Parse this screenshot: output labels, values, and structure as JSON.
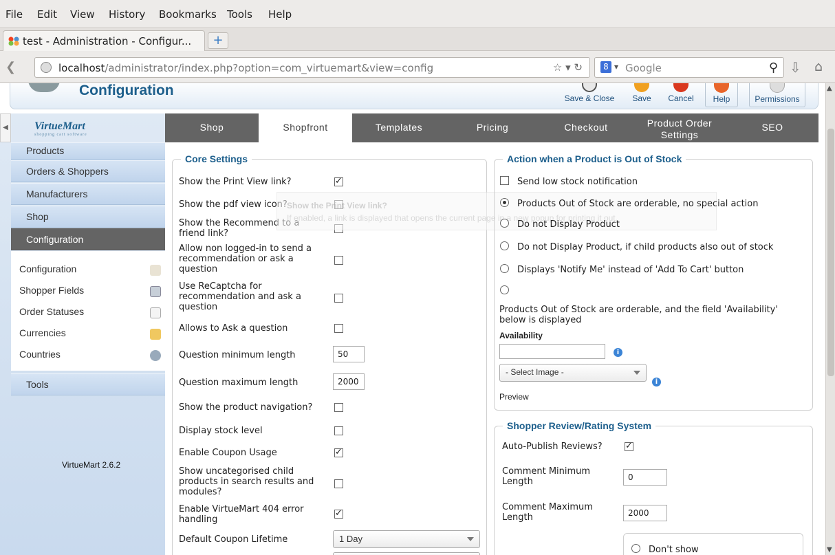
{
  "browser": {
    "menu": [
      "File",
      "Edit",
      "View",
      "History",
      "Bookmarks",
      "Tools",
      "Help"
    ],
    "tab_title": "test - Administration - Configur...",
    "new_tab": "+",
    "url_host": "localhost",
    "url_path": "/administrator/index.php?option=com_virtuemart&view=config",
    "search_engine_letter": "8",
    "search_placeholder": "Google"
  },
  "toolbar": {
    "title": "Configuration",
    "buttons": [
      {
        "label": "Save & Close",
        "icon": "save-close-icon",
        "color": "#555555"
      },
      {
        "label": "Save",
        "icon": "save-icon",
        "color": "#f0a020"
      },
      {
        "label": "Cancel",
        "icon": "cancel-icon",
        "color": "#d9381e"
      },
      {
        "label": "Help",
        "icon": "help-icon",
        "color": "#e8652a"
      },
      {
        "label": "Permissions",
        "icon": "permissions-icon",
        "color": "#aaaaaa"
      }
    ]
  },
  "vm_tabs": [
    {
      "label": "Shop",
      "active": false
    },
    {
      "label": "Shopfront",
      "active": true
    },
    {
      "label": "Templates",
      "active": false
    },
    {
      "label": "Pricing",
      "active": false
    },
    {
      "label": "Checkout",
      "active": false
    },
    {
      "label": "Product Order Settings",
      "active": false
    },
    {
      "label": "SEO",
      "active": false
    }
  ],
  "sidebar": {
    "logo": "VirtueMart",
    "logo_tagline": "shopping cart software",
    "items": [
      "Products",
      "Orders & Shoppers",
      "Manufacturers",
      "Shop",
      "Configuration"
    ],
    "active_item": "Configuration",
    "sub_items": [
      {
        "label": "Configuration",
        "icon": "tools-icon"
      },
      {
        "label": "Shopper Fields",
        "icon": "shopper-fields-icon"
      },
      {
        "label": "Order Statuses",
        "icon": "document-icon"
      },
      {
        "label": "Currencies",
        "icon": "coins-icon"
      },
      {
        "label": "Countries",
        "icon": "globe-icon"
      }
    ],
    "tools": "Tools",
    "version": "VirtueMart 2.6.2"
  },
  "core_settings": {
    "legend": "Core Settings",
    "rows": [
      {
        "label": "Show the Print View link?",
        "checked": true
      },
      {
        "label": "Show the pdf view icon?",
        "checked": false
      },
      {
        "label": "Show the Recommend to a friend link?",
        "checked": false
      },
      {
        "label": "Allow non logged-in to send a recommendation or ask a question",
        "checked": false
      },
      {
        "label": "Use ReCaptcha for recommendation and ask a question",
        "checked": false
      },
      {
        "label": "Allows to Ask a question",
        "checked": false
      },
      {
        "label": "Question minimum length",
        "value": "50"
      },
      {
        "label": "Question maximum length",
        "value": "2000"
      },
      {
        "label": "Show the product navigation?",
        "checked": false
      },
      {
        "label": "Display stock level",
        "checked": false
      },
      {
        "label": "Enable Coupon Usage",
        "checked": true
      },
      {
        "label": "Show uncategorised child products in search results and modules?",
        "checked": false
      },
      {
        "label": "Enable VirtueMart 404 error handling",
        "checked": true
      },
      {
        "label": "Default Coupon Lifetime",
        "value": "1 Day"
      }
    ]
  },
  "tooltip": {
    "title": "Show the Print View link?",
    "body": "If enabled, a link is displayed that opens the current page in a new popup for printing it out."
  },
  "out_of_stock": {
    "legend": "Action when a Product is Out of Stock",
    "notify_label": "Send low stock notification",
    "notify_checked": false,
    "options": [
      {
        "label": "Products Out of Stock are orderable, no special action",
        "selected": true
      },
      {
        "label": "Do not Display Product",
        "selected": false
      },
      {
        "label": "Do not Display Product, if child products also out of stock",
        "selected": false
      },
      {
        "label": "Displays 'Notify Me' instead of 'Add To Cart' button",
        "selected": false
      },
      {
        "label": "Products Out of Stock are orderable, and the field 'Availability' below is displayed",
        "selected": false
      }
    ],
    "availability_label": "Availability",
    "availability_value": "",
    "select_image": "- Select Image -",
    "preview_label": "Preview"
  },
  "reviews": {
    "legend": "Shopper Review/Rating System",
    "auto_publish_label": "Auto-Publish Reviews?",
    "auto_publish_checked": true,
    "comment_min_label": "Comment Minimum Length",
    "comment_min_value": "0",
    "comment_max_label": "Comment Maximum Length",
    "comment_max_value": "2000",
    "dont_show_label": "Don't show"
  }
}
